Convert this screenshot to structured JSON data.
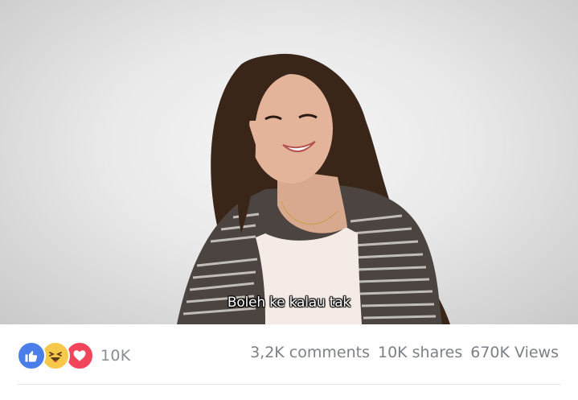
{
  "video": {
    "subtitle": "Boleh ke kalau tak"
  },
  "reactions": {
    "icons": [
      "like-icon",
      "haha-icon",
      "love-icon"
    ],
    "count": "10K"
  },
  "stats": {
    "comments": "3,2K comments",
    "shares": "10K shares",
    "views": "670K Views"
  },
  "colors": {
    "like": "#4a7ee8",
    "haha": "#f7c94a",
    "love": "#f0455b",
    "meta_text": "#7d8085"
  }
}
